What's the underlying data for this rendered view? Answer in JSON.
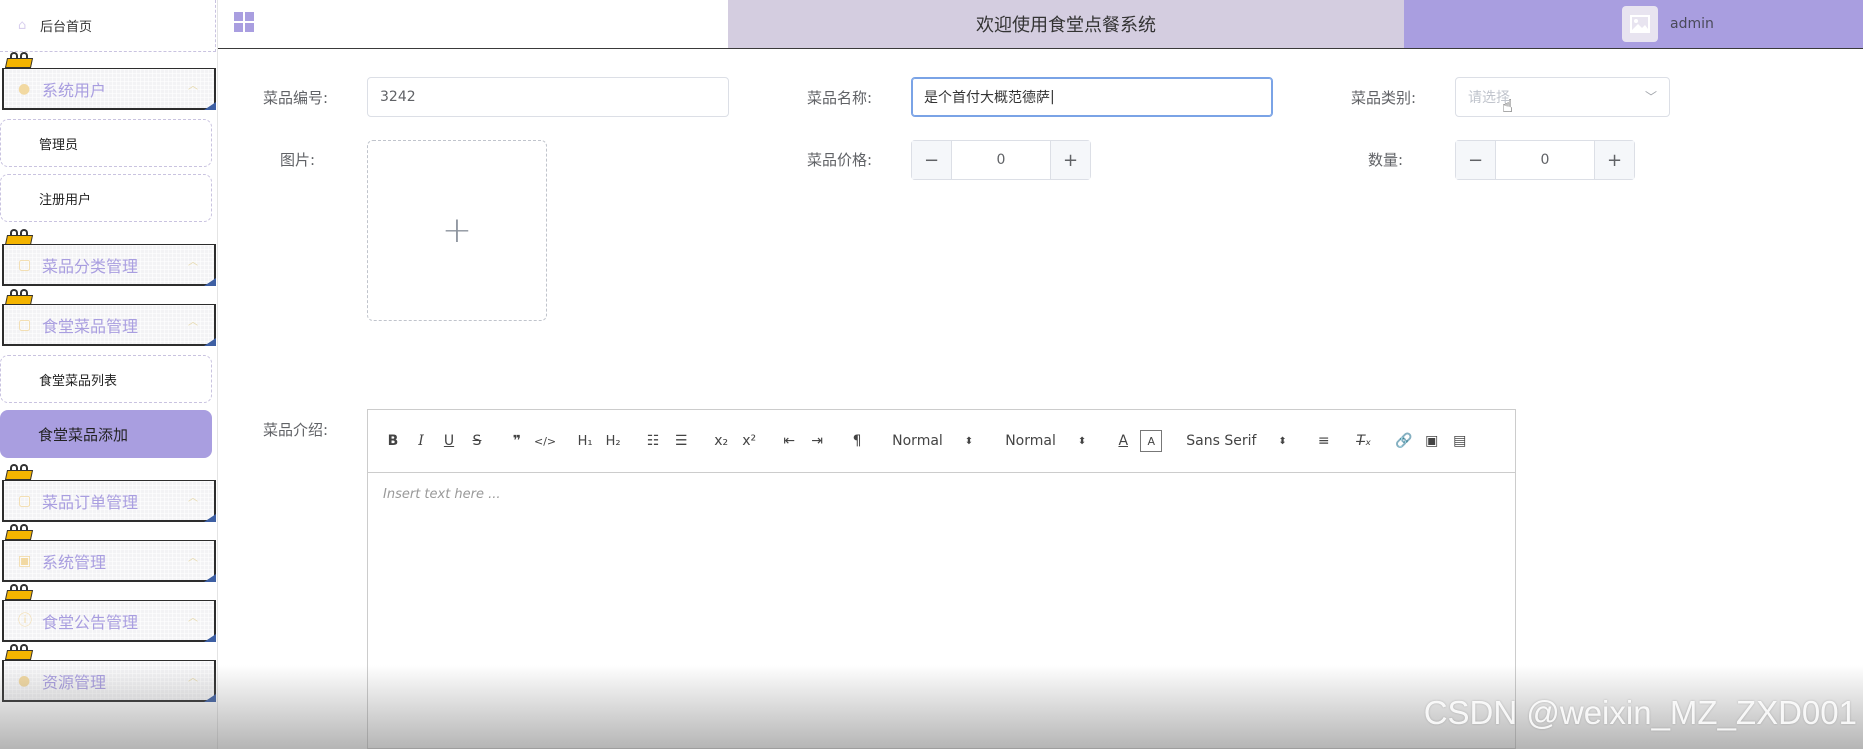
{
  "sidebar": {
    "home_label": "后台首页",
    "menus": [
      {
        "label": "系统用户",
        "icon": "user-icon"
      },
      {
        "label": "菜品分类管理",
        "icon": "folder-icon"
      },
      {
        "label": "食堂菜品管理",
        "icon": "folder-icon"
      },
      {
        "label": "菜品订单管理",
        "icon": "folder-icon"
      },
      {
        "label": "系统管理",
        "icon": "image-icon"
      },
      {
        "label": "食堂公告管理",
        "icon": "info-icon"
      },
      {
        "label": "资源管理",
        "icon": "bulb-icon"
      }
    ],
    "sub_items": {
      "admin": "管理员",
      "registered_users": "注册用户",
      "dish_list": "食堂菜品列表",
      "dish_add": "食堂菜品添加"
    }
  },
  "header": {
    "title": "欢迎使用食堂点餐系统",
    "username": "admin"
  },
  "form": {
    "dish_code_label": "菜品编号:",
    "dish_code_value": "3242",
    "dish_name_label": "菜品名称:",
    "dish_name_value": "是个首付大概范德萨",
    "dish_category_label": "菜品类别:",
    "dish_category_placeholder": "请选择",
    "image_label": "图片:",
    "upload_plus": "+",
    "price_label": "菜品价格:",
    "price_value": "0",
    "quantity_label": "数量:",
    "quantity_value": "0",
    "intro_label": "菜品介绍:"
  },
  "editor": {
    "header_select": "Normal",
    "size_select": "Normal",
    "font_select": "Sans Serif",
    "placeholder": "Insert text here ..."
  },
  "watermark": "CSDN @weixin_MZ_ZXD001",
  "colors": {
    "accent": "#a99ee0",
    "header_bg": "#d4cde0",
    "focus_border": "#7aa3e6"
  }
}
